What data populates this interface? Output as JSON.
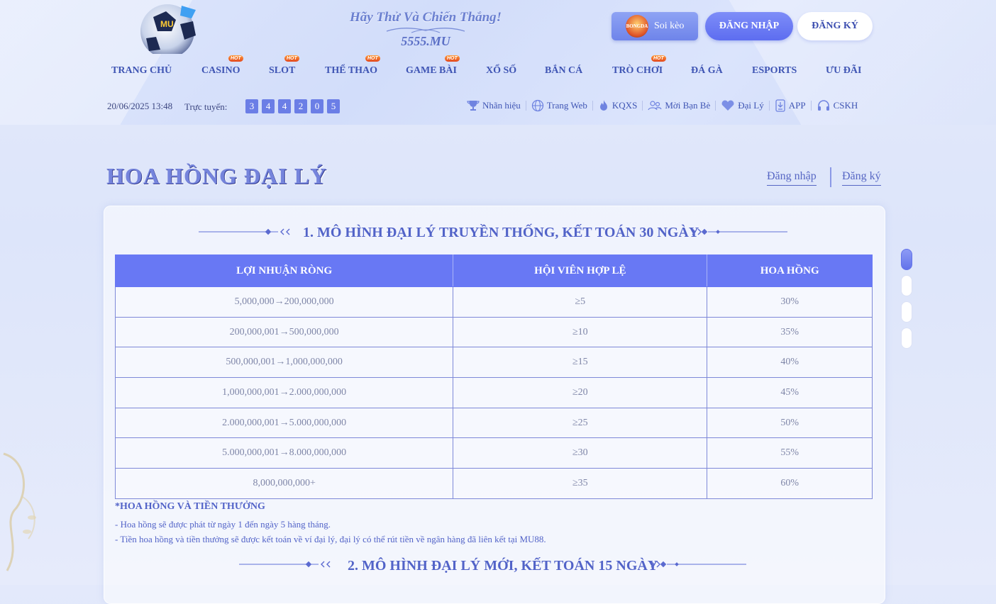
{
  "header": {
    "tagline": "Hãy Thử Và Chiến Thắng!",
    "domain": "5555.MU",
    "soikeo_label": "Soi kèo",
    "soikeo_badge": "BONGDA",
    "login_label": "ĐĂNG NHẬP",
    "register_label": "ĐĂNG KÝ"
  },
  "nav": {
    "items": [
      {
        "label": "TRANG CHỦ",
        "hot": false
      },
      {
        "label": "CASINO",
        "hot": true
      },
      {
        "label": "SLOT",
        "hot": true
      },
      {
        "label": "THỂ THAO",
        "hot": true
      },
      {
        "label": "GAME BÀI",
        "hot": true
      },
      {
        "label": "XỔ SỐ",
        "hot": false
      },
      {
        "label": "BẮN CÁ",
        "hot": false
      },
      {
        "label": "TRÒ CHƠI",
        "hot": true
      },
      {
        "label": "ĐÁ GÀ",
        "hot": false
      },
      {
        "label": "ESPORTS",
        "hot": false
      },
      {
        "label": "ƯU ĐÃI",
        "hot": false
      }
    ],
    "hot_label": "HOT"
  },
  "status": {
    "datetime": "20/06/2025 13:48",
    "online_label": "Trực tuyến:",
    "online_digits": [
      "3",
      "4",
      "4",
      "2",
      "0",
      "5"
    ]
  },
  "quick_links": [
    {
      "label": "Nhãn hiệu",
      "icon": "trophy-icon"
    },
    {
      "label": "Trang Web",
      "icon": "globe-icon"
    },
    {
      "label": "KQXS",
      "icon": "flame-icon"
    },
    {
      "label": "Mời Bạn Bè",
      "icon": "friends-icon"
    },
    {
      "label": "Đại Lý",
      "icon": "heart-icon"
    },
    {
      "label": "APP",
      "icon": "download-icon"
    },
    {
      "label": "CSKH",
      "icon": "headset-icon"
    }
  ],
  "page": {
    "title": "HOA HỒNG ĐẠI LÝ",
    "login_link": "Đăng nhập",
    "register_link": "Đăng ký"
  },
  "section1": {
    "title": "1. MÔ HÌNH ĐẠI LÝ TRUYỀN THỐNG, KẾT TOÁN 30 NGÀY",
    "headers": [
      "LỢI NHUẬN RÒNG",
      "HỘI VIÊN HỢP LỆ",
      "HOA HỒNG"
    ],
    "rows": [
      [
        "5,000,000→200,000,000",
        "≥5",
        "30%"
      ],
      [
        "200,000,001→500,000,000",
        "≥10",
        "35%"
      ],
      [
        "500,000,001→1,000,000,000",
        "≥15",
        "40%"
      ],
      [
        "1,000,000,001→2.000,000,000",
        "≥20",
        "45%"
      ],
      [
        "2.000,000,001→5.000,000,000",
        "≥25",
        "50%"
      ],
      [
        "5.000,000,001→8.000,000,000",
        "≥30",
        "55%"
      ],
      [
        "8,000,000,000+",
        "≥35",
        "60%"
      ]
    ],
    "notes_title": "*HOA HỒNG VÀ TIỀN THƯỞNG",
    "notes": [
      "- Hoa hồng sẽ được phát từ ngày 1 đến ngày 5 hàng tháng.",
      "- Tiền hoa hồng và tiền thưởng sẽ được kết toán về ví đại lý, đại lý có thể rút tiền về ngân hàng đã liên kết tại MU88."
    ]
  },
  "section2": {
    "title": "2. MÔ HÌNH ĐẠI LÝ MỚI, KẾT TOÁN 15 NGÀY"
  },
  "colors": {
    "accent": "#6878f4",
    "text": "#5263c8",
    "table_text": "#7f86a8"
  }
}
